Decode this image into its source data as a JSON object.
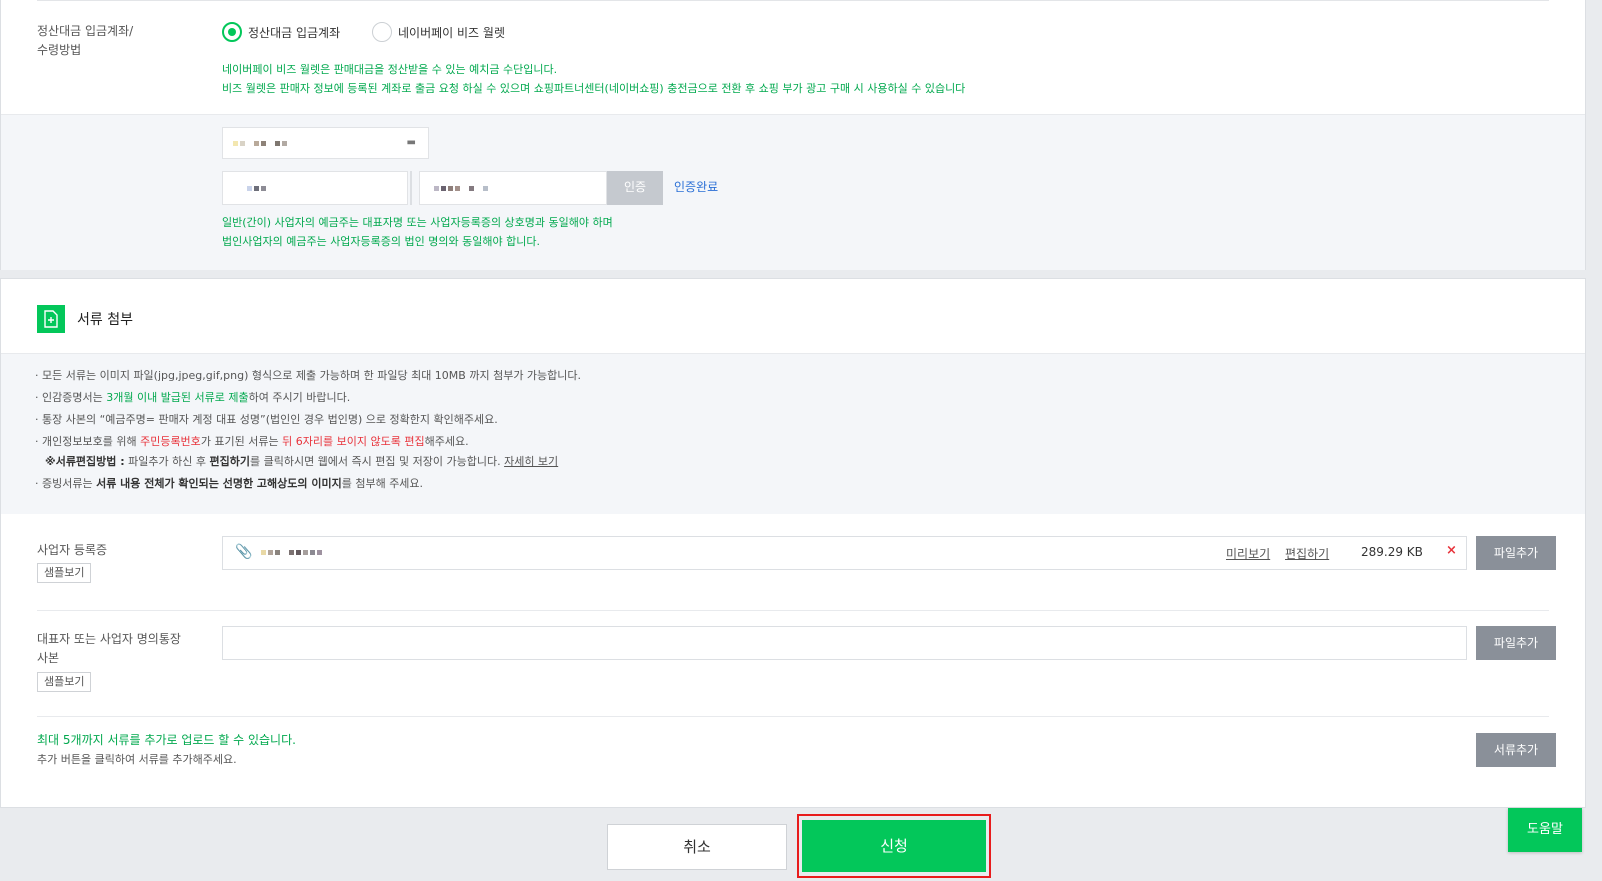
{
  "settlement": {
    "label_line1": "정산대금 입금계좌/",
    "label_line2": "수령방법",
    "option_account": "정산대금 입금계좌",
    "option_wallet": "네이버페이 비즈 월렛",
    "note_line1": "네이버페이 비즈 월렛은 판매대금을 정산받을 수 있는 예치금 수단입니다.",
    "note_line2": "비즈 월렛은 판매자 정보에 등록된 계좌로 출금 요청 하실 수 있으며 쇼핑파트너센터(네이버쇼핑) 충전금으로 전환 후 쇼핑 부가 광고 구매 시 사용하실 수 있습니다",
    "verify_button": "인증",
    "verify_status": "인증완료",
    "holder_note_line1": "일반(간이) 사업자의 예금주는 대표자명 또는 사업자등록증의 상호명과 동일해야 하며",
    "holder_note_line2": "법인사업자의 예금주는 사업자등록증의 법인 명의와 동일해야 합니다."
  },
  "documents": {
    "section_title": "서류 첨부",
    "guide": {
      "l1": "· 모든 서류는 이미지 파일(jpg,jpeg,gif,png) 형식으로 제출 가능하며 한 파일당 최대 10MB 까지 첨부가 가능합니다.",
      "l2a": "· 인감증명서는 ",
      "l2b": "3개월 이내 발급된 서류로 제출",
      "l2c": "하여 주시기 바랍니다.",
      "l3": "· 통장 사본의 “예금주명= 판매자 계정 대표 성명”(법인인 경우 법인명) 으로 정확한지 확인해주세요.",
      "l4a": "· 개인정보보호를 위해 ",
      "l4b": "주민등록번호",
      "l4c": "가 표기된 서류는 ",
      "l4d": "뒤 6자리를 보이지 않도록 편집",
      "l4e": "해주세요.",
      "l5a": "※서류편집방법 :",
      "l5b": " 파일추가 하신 후 ",
      "l5c": "편집하기",
      "l5d": "를 클릭하시면 웹에서 즉시 편집 및 저장이 가능합니다. ",
      "l5e": "자세히 보기",
      "l6a": "· 증빙서류는 ",
      "l6b": "서류 내용 전체가 확인되는 선명한 고해상도의 이미지",
      "l6c": "를 첨부해 주세요."
    },
    "business_reg": {
      "label": "사업자 등록증",
      "sample": "샘플보기",
      "preview": "미리보기",
      "edit": "편집하기",
      "size": "289.29 KB",
      "remove": "×",
      "add_file": "파일추가"
    },
    "bankbook": {
      "label_line1": "대표자 또는 사업자 명의통장",
      "label_line2": "사본",
      "sample": "샘플보기",
      "add_file": "파일추가"
    },
    "extra": {
      "note_line1": "최대 5개까지 서류를 추가로 업로드 할 수 있습니다.",
      "note_line2": "추가 버튼을 클릭하여 서류를 추가해주세요.",
      "add_document": "서류추가"
    }
  },
  "footer": {
    "cancel": "취소",
    "submit": "신청",
    "help": "도움말"
  },
  "colors": {
    "accent": "#03c75a",
    "highlight_outline": "#e81c1c",
    "link": "#2a6fd6"
  }
}
